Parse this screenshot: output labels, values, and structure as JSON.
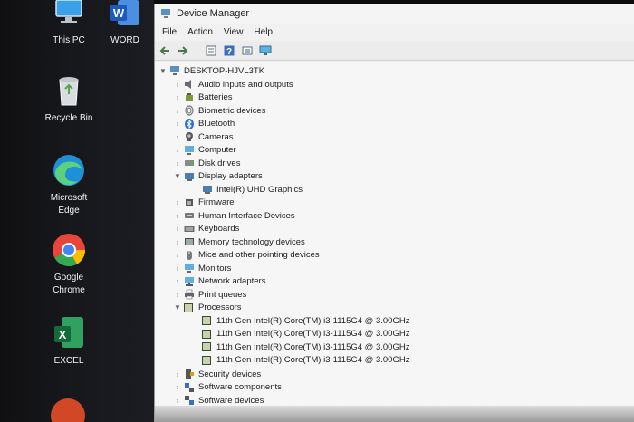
{
  "desktop": {
    "icons": [
      {
        "label": "This PC",
        "icon": "this-pc-icon"
      },
      {
        "label": "WORD",
        "icon": "word-icon"
      },
      {
        "label": "Recycle Bin",
        "icon": "recycle-bin-icon"
      },
      {
        "label": "Microsoft\nEdge",
        "icon": "edge-icon"
      },
      {
        "label": "Google\nChrome",
        "icon": "chrome-icon"
      },
      {
        "label": "EXCEL",
        "icon": "excel-icon"
      }
    ]
  },
  "window": {
    "title": "Device Manager",
    "menu": [
      "File",
      "Action",
      "View",
      "Help"
    ],
    "toolbar": [
      "back-icon",
      "forward-icon",
      "properties-icon",
      "help-icon",
      "driver-icon",
      "monitor-icon"
    ]
  },
  "tree": {
    "root": "DESKTOP-HJVL3TK",
    "items": [
      {
        "label": "Audio inputs and outputs",
        "icon": "speaker-icon",
        "expanded": false
      },
      {
        "label": "Batteries",
        "icon": "battery-icon",
        "expanded": false
      },
      {
        "label": "Biometric devices",
        "icon": "fingerprint-icon",
        "expanded": false
      },
      {
        "label": "Bluetooth",
        "icon": "bluetooth-icon",
        "expanded": false
      },
      {
        "label": "Cameras",
        "icon": "camera-icon",
        "expanded": false
      },
      {
        "label": "Computer",
        "icon": "computer-icon",
        "expanded": false
      },
      {
        "label": "Disk drives",
        "icon": "disk-icon",
        "expanded": false
      },
      {
        "label": "Display adapters",
        "icon": "display-adapter-icon",
        "expanded": true,
        "children": [
          "Intel(R) UHD Graphics"
        ]
      },
      {
        "label": "Firmware",
        "icon": "firmware-icon",
        "expanded": false
      },
      {
        "label": "Human Interface Devices",
        "icon": "hid-icon",
        "expanded": false
      },
      {
        "label": "Keyboards",
        "icon": "keyboard-icon",
        "expanded": false
      },
      {
        "label": "Memory technology devices",
        "icon": "memory-icon",
        "expanded": false
      },
      {
        "label": "Mice and other pointing devices",
        "icon": "mouse-icon",
        "expanded": false
      },
      {
        "label": "Monitors",
        "icon": "monitor-icon",
        "expanded": false
      },
      {
        "label": "Network adapters",
        "icon": "network-icon",
        "expanded": false
      },
      {
        "label": "Print queues",
        "icon": "printer-icon",
        "expanded": false
      },
      {
        "label": "Processors",
        "icon": "processor-icon",
        "expanded": true,
        "children": [
          "11th Gen Intel(R) Core(TM) i3-1115G4 @ 3.00GHz",
          "11th Gen Intel(R) Core(TM) i3-1115G4 @ 3.00GHz",
          "11th Gen Intel(R) Core(TM) i3-1115G4 @ 3.00GHz",
          "11th Gen Intel(R) Core(TM) i3-1115G4 @ 3.00GHz"
        ]
      },
      {
        "label": "Security devices",
        "icon": "security-icon",
        "expanded": false
      },
      {
        "label": "Software components",
        "icon": "software-component-icon",
        "expanded": false
      },
      {
        "label": "Software devices",
        "icon": "software-device-icon",
        "expanded": false
      }
    ]
  }
}
